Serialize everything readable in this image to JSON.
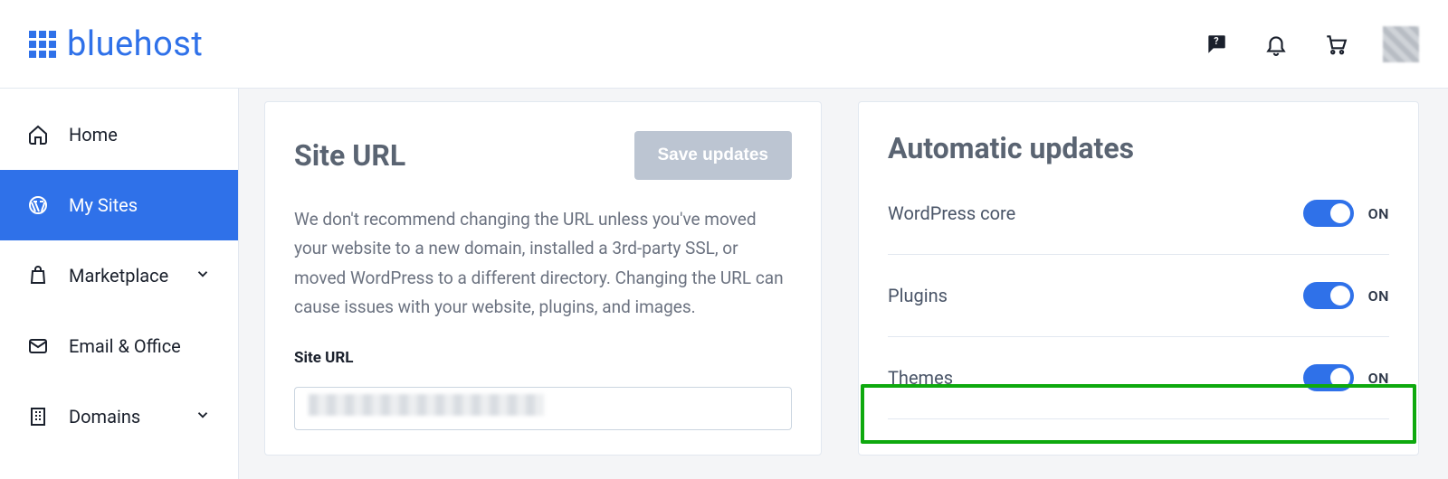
{
  "brand": {
    "name": "bluehost"
  },
  "sidebar": {
    "items": [
      {
        "label": "Home"
      },
      {
        "label": "My Sites"
      },
      {
        "label": "Marketplace"
      },
      {
        "label": "Email & Office"
      },
      {
        "label": "Domains"
      }
    ]
  },
  "site_url_card": {
    "title": "Site URL",
    "save_label": "Save updates",
    "description": "We don't recommend changing the URL unless you've moved your website to a new domain, installed a 3rd-party SSL, or moved WordPress to a different directory. Changing the URL can cause issues with your website, plugins, and images.",
    "field_label": "Site URL",
    "field_value": ""
  },
  "auto_updates_card": {
    "title": "Automatic updates",
    "rows": [
      {
        "label": "WordPress core",
        "state": "ON"
      },
      {
        "label": "Plugins",
        "state": "ON"
      },
      {
        "label": "Themes",
        "state": "ON"
      }
    ]
  }
}
